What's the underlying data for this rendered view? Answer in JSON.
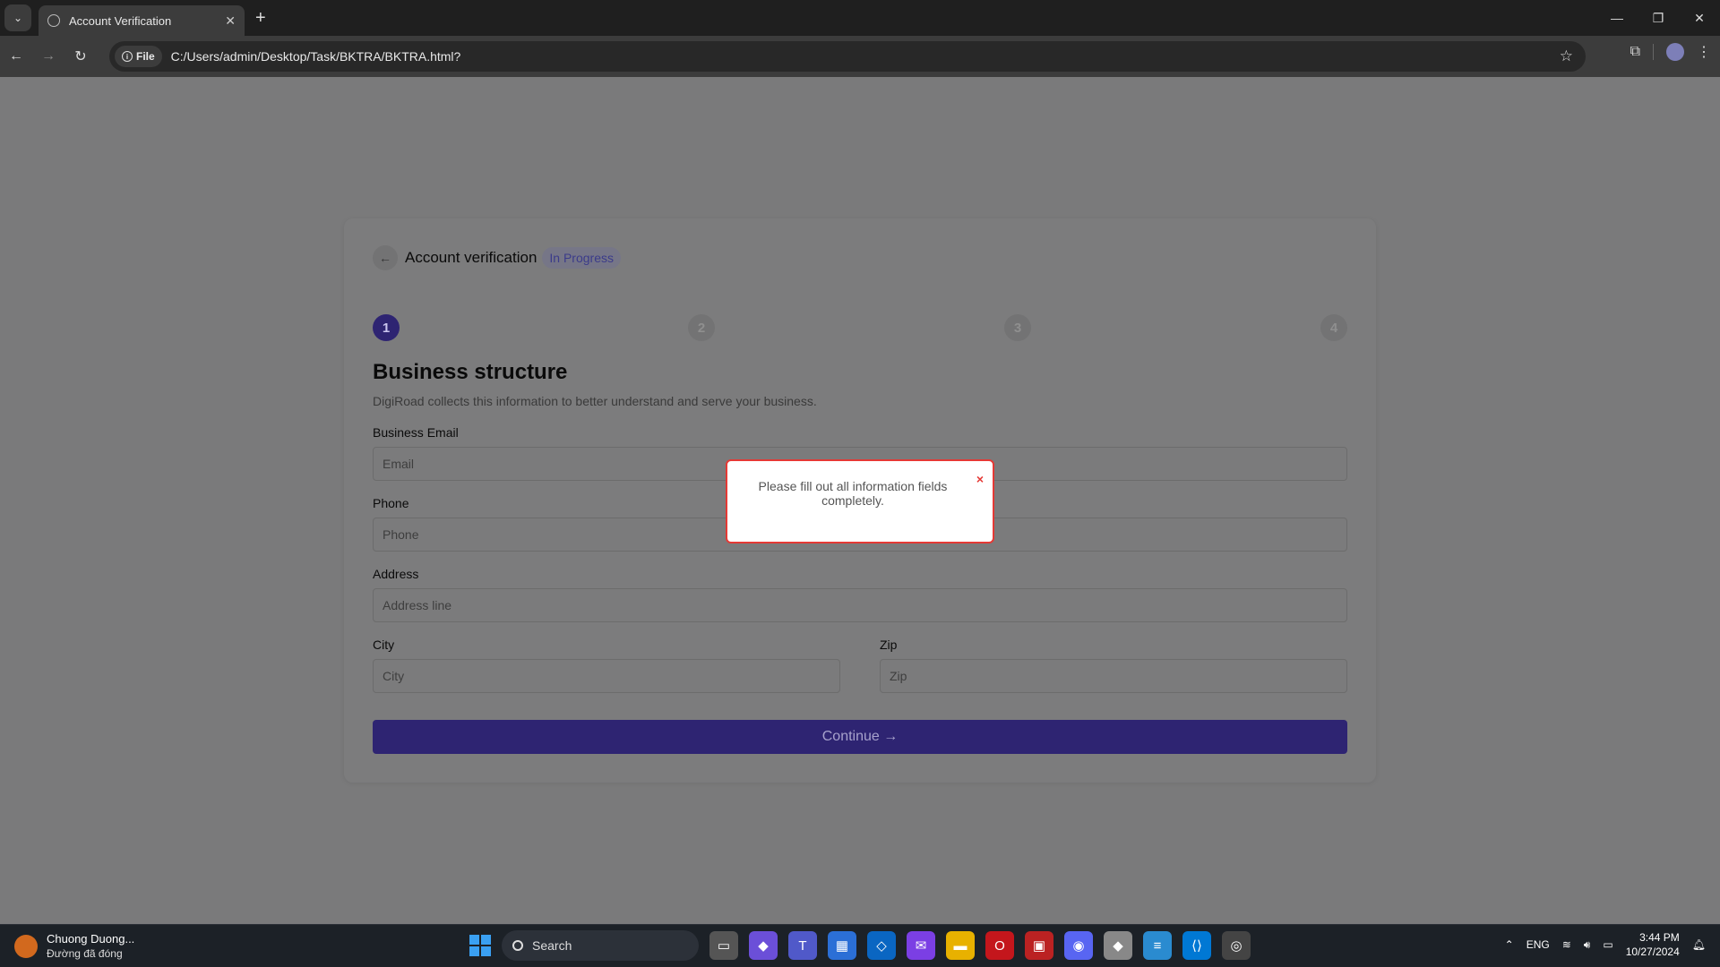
{
  "browser": {
    "tab_title": "Account Verification",
    "chip_label": "File",
    "url": "C:/Users/admin/Desktop/Task/BKTRA/BKTRA.html?"
  },
  "card": {
    "title": "Account verification",
    "badge": "In Progress",
    "steps": [
      "1",
      "2",
      "3",
      "4"
    ],
    "active_step": 1,
    "heading": "Business structure",
    "subtitle": "DigiRoad collects this information to better understand and serve your business.",
    "fields": {
      "email_label": "Business Email",
      "email_placeholder": "Email",
      "phone_label": "Phone",
      "phone_placeholder": "Phone",
      "address_label": "Address",
      "address_placeholder": "Address line",
      "city_label": "City",
      "city_placeholder": "City",
      "zip_label": "Zip",
      "zip_placeholder": "Zip"
    },
    "continue_label": "Continue →"
  },
  "toast": {
    "message": "Please fill out all information fields completely.",
    "close": "×"
  },
  "taskbar": {
    "user_line1": "Chuong Duong...",
    "user_line2": "Đường đã đóng",
    "search_label": "Search",
    "lang": "ENG",
    "time": "3:44 PM",
    "date": "10/27/2024"
  },
  "colors": {
    "accent": "#2e2472",
    "toast_border": "#e53935"
  }
}
